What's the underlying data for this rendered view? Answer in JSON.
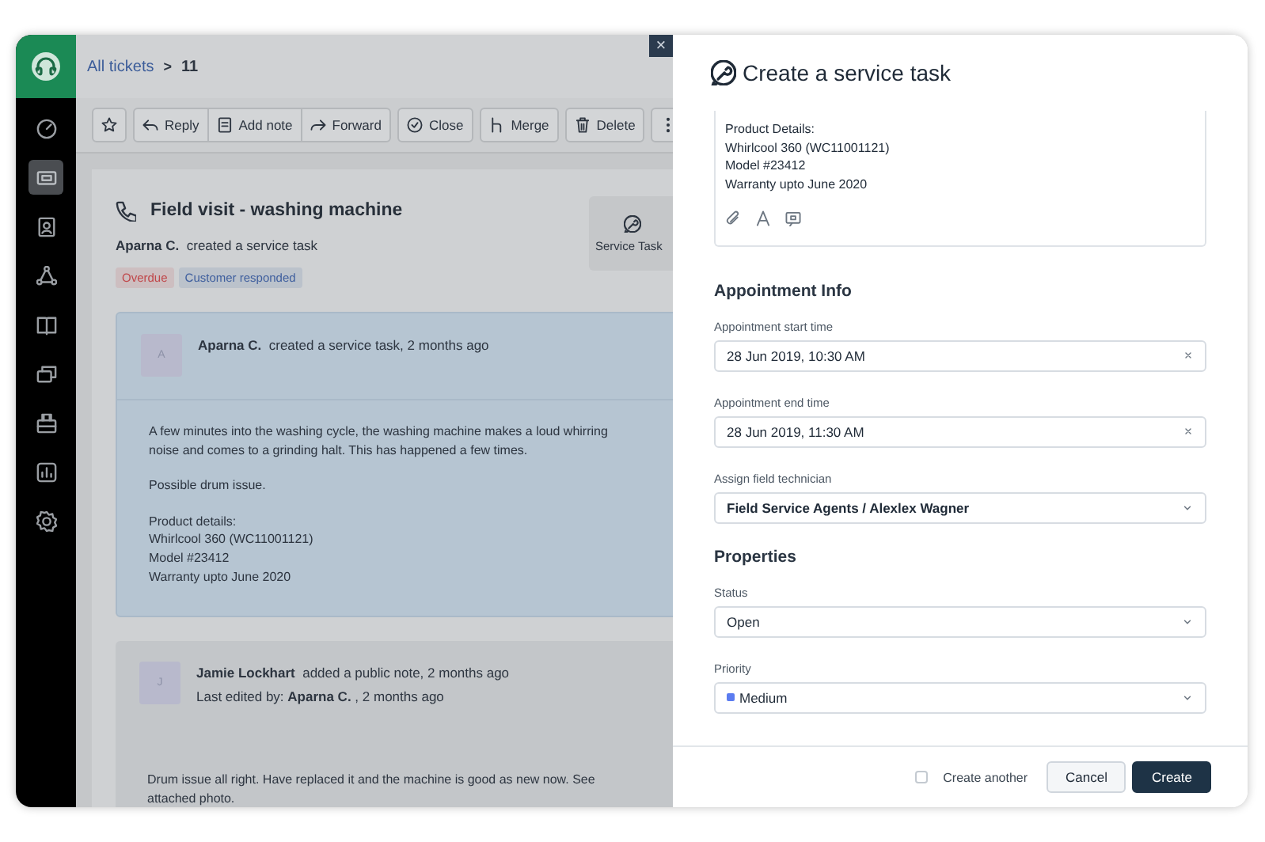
{
  "sidebar": {
    "logo": {
      "kind": "headset"
    },
    "items": [
      {
        "kind": "dashboard",
        "selected": false
      },
      {
        "kind": "tickets",
        "selected": true
      },
      {
        "kind": "contacts",
        "selected": false
      },
      {
        "kind": "social",
        "selected": false
      },
      {
        "kind": "book",
        "selected": false
      },
      {
        "kind": "chat",
        "selected": false
      },
      {
        "kind": "toolbox",
        "selected": false
      },
      {
        "kind": "analytics",
        "selected": false
      },
      {
        "kind": "settings",
        "selected": false
      }
    ]
  },
  "breadcrumb": {
    "link": "All tickets",
    "separator": ">",
    "current": "11"
  },
  "toolbar": [
    [
      {
        "kind": "star"
      }
    ],
    [
      {
        "kind": "reply",
        "label": "Reply"
      },
      {
        "kind": "note",
        "label": "Add note"
      },
      {
        "kind": "forward",
        "label": "Forward"
      }
    ],
    [
      {
        "kind": "close",
        "label": "Close"
      }
    ],
    [
      {
        "kind": "merge",
        "label": "Merge"
      }
    ],
    [
      {
        "kind": "delete",
        "label": "Delete"
      }
    ],
    [
      {
        "kind": "more"
      }
    ]
  ],
  "ticket": {
    "title": "Field visit - washing machine",
    "author": "Aparna C.",
    "action": "created a service task",
    "tags": [
      {
        "label": "Overdue",
        "color": "#c0474a"
      },
      {
        "label": "Customer responded",
        "color": "#3f5f9e"
      }
    ],
    "side_button": "Service Task",
    "conversations": [
      {
        "avatar": "A",
        "author": "Aparna C.",
        "action": "created a service task, 2 months ago",
        "highlighted": true,
        "body": [
          "A few minutes into the washing cycle, the washing machine makes a loud whirring noise and comes to a grinding halt. This has happened a few times.",
          "Possible drum issue.",
          "Product details:\nWhirlcool 360 (WC11001121)\nModel #23412\nWarranty upto June 2020"
        ]
      },
      {
        "avatar": "J",
        "author": "Jamie Lockhart",
        "action": "added a public note, 2 months ago",
        "highlighted": false,
        "edited": {
          "label": "Last edited by:",
          "by": "Aparna C.",
          "time": ", 2 months ago"
        },
        "body": [
          "Drum issue all right. Have replaced it and the machine is good as new now. See attached photo."
        ]
      }
    ]
  },
  "close_button": "×",
  "panel": {
    "title": "Create a service task",
    "editor": {
      "lines": [
        "Product Details:",
        "Whirlcool 360 (WC11001121)",
        "Model #23412",
        "Warranty upto June 2020"
      ],
      "tools": [
        {
          "kind": "attach"
        },
        {
          "kind": "font"
        },
        {
          "kind": "canned"
        }
      ]
    },
    "sections": [
      {
        "heading": "Appointment Info",
        "fields": [
          {
            "label": "Appointment start time",
            "value": "28 Jun 2019, 10:30 AM",
            "kind": "clearable"
          },
          {
            "label": "Appointment end time",
            "value": "28 Jun 2019, 11:30 AM",
            "kind": "clearable"
          },
          {
            "label": "Assign field technician",
            "value": "Field Service Agents / Alexlex Wagner",
            "kind": "select",
            "bold": true
          }
        ]
      },
      {
        "heading": "Properties",
        "fields": [
          {
            "label": "Status",
            "value": "Open",
            "kind": "select"
          },
          {
            "label": "Priority",
            "value": "Medium",
            "kind": "select",
            "color": "#5b7cf0"
          }
        ]
      }
    ],
    "footer": {
      "create_another": {
        "label": "Create another",
        "checked": false
      },
      "buttons": [
        {
          "label": "Cancel",
          "kind": "secondary"
        },
        {
          "label": "Create",
          "kind": "primary"
        }
      ]
    }
  }
}
